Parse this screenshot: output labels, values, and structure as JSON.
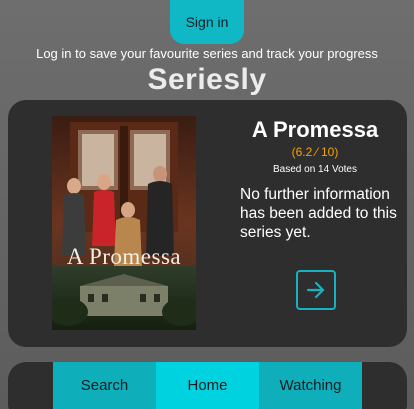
{
  "header": {
    "signin_label": "Sign in",
    "tagline": "Log in to save your favourite series and track your progress",
    "app_title": "Seriesly"
  },
  "series": {
    "poster_text": "A Promessa",
    "title": "A Promessa",
    "rating": "(6.2 ⁄ 10)",
    "votes": "Based on 14 Votes",
    "description": "No further information has been added to this series yet.",
    "open_icon": "arrow-right-icon"
  },
  "nav": {
    "tabs": [
      {
        "label": "Search"
      },
      {
        "label": "Home"
      },
      {
        "label": "Watching"
      }
    ],
    "active": "Home"
  },
  "colors": {
    "accent": "#0eaebb",
    "accent_active": "#00d2e0",
    "rating": "#f5a300",
    "card_bg": "#2e2e2e"
  }
}
